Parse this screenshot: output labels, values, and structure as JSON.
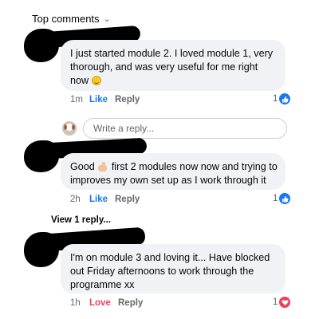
{
  "header": {
    "title": "Top comments",
    "chevron": "chevron-down-icon"
  },
  "comments": [
    {
      "text": "I just started module 2.  I loved module 1, very thorough, and was very useful for me right now",
      "emoji": "smiley-emoji",
      "time": "1m",
      "reaction_action": "Like",
      "reply_action": "Reply",
      "reaction_count": "1",
      "reaction_icon": "like-icon"
    },
    {
      "text_before": "Good",
      "emoji": "thumbs-up-emoji",
      "text_after": "first 2 modules now now and trying to improves my own set up as I work through it",
      "time": "2h",
      "reaction_action": "Like",
      "reply_action": "Reply",
      "reaction_count": "1",
      "reaction_icon": "like-icon"
    },
    {
      "text": "I'm on module 3 and loving it... Have blocked out Friday afternoons to work through the programme xx",
      "time": "1h",
      "reaction_action": "Love",
      "reply_action": "Reply",
      "reaction_count": "1",
      "reaction_icon": "love-icon"
    }
  ],
  "reply_box": {
    "placeholder": "Write a reply..."
  },
  "view_replies": "View 1 reply...",
  "colors": {
    "like": "#1877f2",
    "love": "#f33e58",
    "bubble": "#f0f2f5",
    "muted": "#65676b"
  }
}
